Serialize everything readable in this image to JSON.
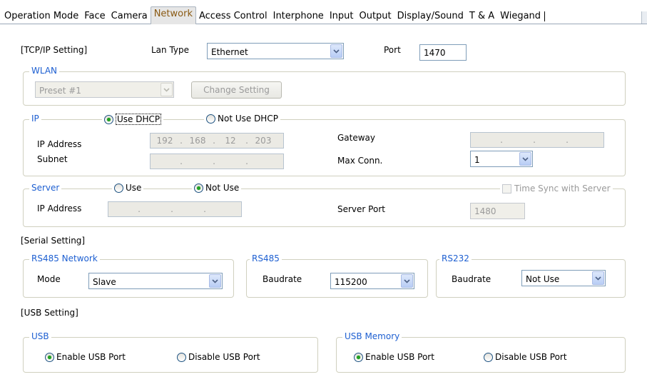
{
  "tabs": [
    {
      "label": "Operation Mode",
      "active": false
    },
    {
      "label": "Face",
      "active": false
    },
    {
      "label": "Camera",
      "active": false
    },
    {
      "label": "Network",
      "active": true
    },
    {
      "label": "Access Control",
      "active": false
    },
    {
      "label": "Interphone",
      "active": false
    },
    {
      "label": "Input",
      "active": false
    },
    {
      "label": "Output",
      "active": false
    },
    {
      "label": "Display/Sound",
      "active": false
    },
    {
      "label": "T & A",
      "active": false
    },
    {
      "label": "Wiegand",
      "active": false
    }
  ],
  "tcpip": {
    "section_label": "[TCP/IP Setting]",
    "lan_type_label": "Lan Type",
    "lan_type_value": "Ethernet",
    "port_label": "Port",
    "port_value": "1470"
  },
  "wlan": {
    "legend": "WLAN",
    "preset_value": "Preset #1",
    "change_setting_label": "Change Setting"
  },
  "ip": {
    "legend": "IP",
    "use_dhcp_label": "Use DHCP",
    "not_use_dhcp_label": "Not Use DHCP",
    "use_dhcp_selected": true,
    "ip_address_label": "IP Address",
    "ip_address_octets": [
      "192",
      "168",
      "12",
      "203"
    ],
    "subnet_label": "Subnet",
    "gateway_label": "Gateway",
    "max_conn_label": "Max Conn.",
    "max_conn_value": "1"
  },
  "server": {
    "legend": "Server",
    "use_label": "Use",
    "not_use_label": "Not Use",
    "not_use_selected": true,
    "time_sync_label": "Time Sync with Server",
    "ip_address_label": "IP Address",
    "server_port_label": "Server Port",
    "server_port_value": "1480"
  },
  "serial": {
    "section_label": "[Serial Setting]",
    "rs485_network": {
      "legend": "RS485 Network",
      "mode_label": "Mode",
      "mode_value": "Slave"
    },
    "rs485": {
      "legend": "RS485",
      "baudrate_label": "Baudrate",
      "baudrate_value": "115200"
    },
    "rs232": {
      "legend": "RS232",
      "baudrate_label": "Baudrate",
      "baudrate_value": "Not Use"
    }
  },
  "usb": {
    "section_label": "[USB Setting]",
    "usb_group": {
      "legend": "USB",
      "enable_label": "Enable USB Port",
      "disable_label": "Disable USB Port",
      "enabled": true
    },
    "usb_memory": {
      "legend": "USB Memory",
      "enable_label": "Enable USB Port",
      "disable_label": "Disable USB Port",
      "enabled": true
    }
  },
  "colors": {
    "legend": "#1d5fd1",
    "active_tab_text": "#8a5a13",
    "radio_selected": "#21a121"
  }
}
